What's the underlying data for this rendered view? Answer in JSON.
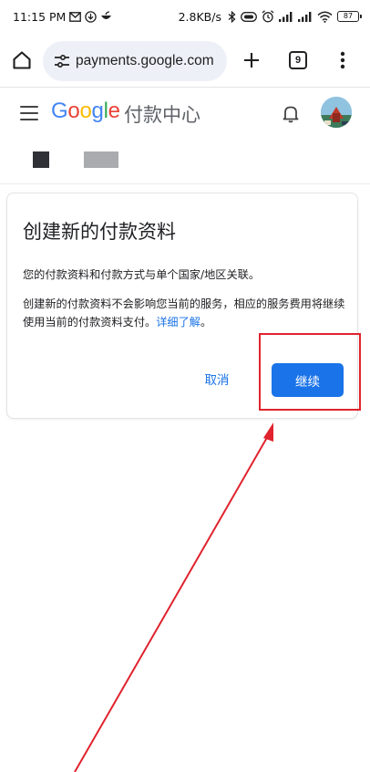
{
  "status_bar": {
    "time": "11:15 PM",
    "net_speed": "2.8KB/s",
    "battery": "87"
  },
  "browser": {
    "url": "payments.google.com",
    "tab_count": "9"
  },
  "app": {
    "logo": [
      "G",
      "o",
      "o",
      "g",
      "l",
      "e"
    ],
    "name": "付款中心"
  },
  "dialog": {
    "title": "创建新的付款资料",
    "paragraph1": "您的付款资料和付款方式与单个国家/地区关联。",
    "paragraph2": "创建新的付款资料不会影响您当前的服务，相应的服务费用将继续使用当前的付款资料支付。",
    "learn_more": "详细了解",
    "learn_more_suffix": "。",
    "cancel_label": "取消",
    "continue_label": "继续"
  },
  "colors": {
    "accent": "#1a73e8",
    "annotation": "#e0232e"
  }
}
